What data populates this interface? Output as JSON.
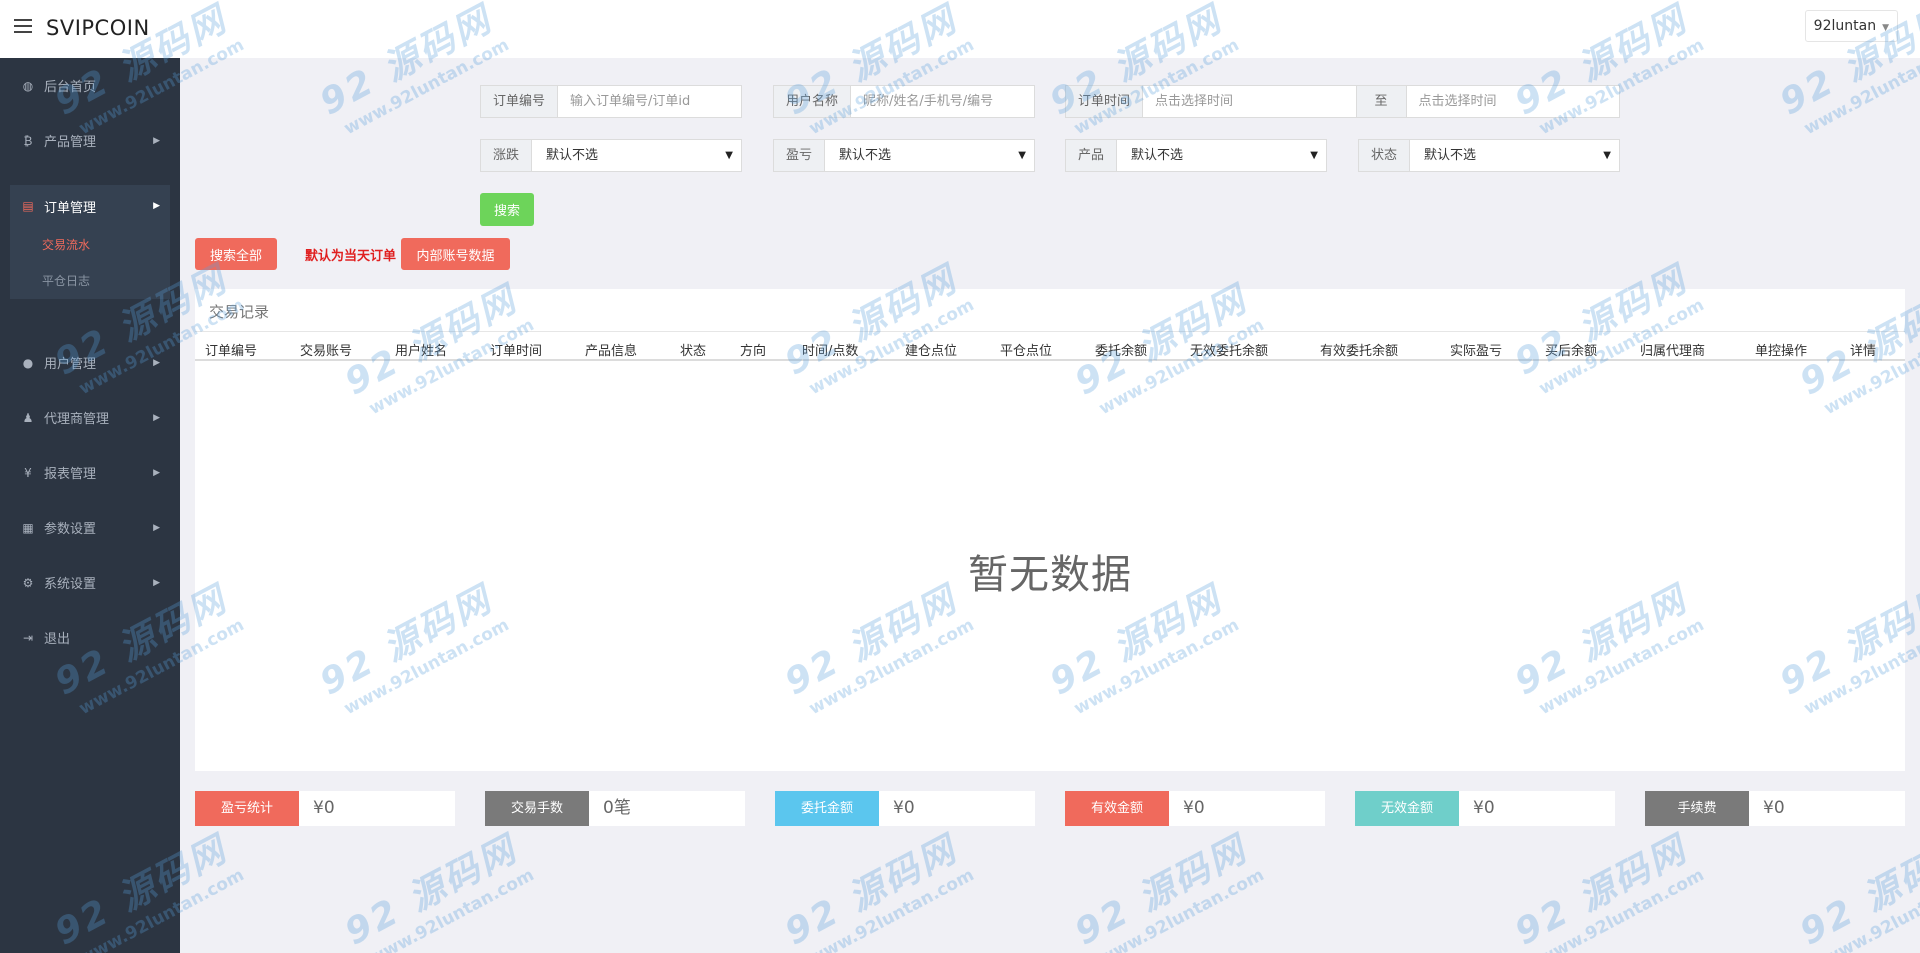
{
  "header": {
    "logo": "SVIPCOIN",
    "user": "92luntan"
  },
  "sidebar": {
    "items": [
      {
        "icon": "dashboard-icon",
        "glyph": "◍",
        "label": "后台首页"
      },
      {
        "icon": "bitcoin-icon",
        "glyph": "₿",
        "label": "产品管理"
      },
      {
        "icon": "orders-icon",
        "glyph": "▤",
        "label": "订单管理"
      },
      {
        "icon": "user-icon",
        "glyph": "●",
        "label": "用户管理"
      },
      {
        "icon": "agent-icon",
        "glyph": "♟",
        "label": "代理商管理"
      },
      {
        "icon": "yen-icon",
        "glyph": "¥",
        "label": "报表管理"
      },
      {
        "icon": "params-icon",
        "glyph": "▦",
        "label": "参数设置"
      },
      {
        "icon": "gears-icon",
        "glyph": "⚙",
        "label": "系统设置"
      },
      {
        "icon": "logout-icon",
        "glyph": "⇥",
        "label": "退出"
      }
    ],
    "sub_items": [
      {
        "label": "交易流水"
      },
      {
        "label": "平仓日志"
      }
    ]
  },
  "filters": {
    "order_no": {
      "label": "订单编号",
      "placeholder": "输入订单编号/订单id"
    },
    "user_name": {
      "label": "用户名称",
      "placeholder": "昵称/姓名/手机号/编号"
    },
    "order_time": {
      "label": "订单时间",
      "placeholder": "点击选择时间",
      "to": "至",
      "placeholder2": "点击选择时间"
    },
    "rise_fall": {
      "label": "涨跌",
      "value": "默认不选"
    },
    "profit_loss": {
      "label": "盈亏",
      "value": "默认不选"
    },
    "product": {
      "label": "产品",
      "value": "默认不选"
    },
    "status": {
      "label": "状态",
      "value": "默认不选"
    },
    "search_button": "搜索"
  },
  "actions": {
    "search_all": "搜索全部",
    "default_note": "默认为当天订单",
    "internal_accounts": "内部账号数据"
  },
  "table": {
    "title": "交易记录",
    "columns": [
      "订单编号",
      "交易账号",
      "用户姓名",
      "订单时间",
      "产品信息",
      "状态",
      "方向",
      "时间/点数",
      "建仓点位",
      "平仓点位",
      "委托余额",
      "无效委托余额",
      "有效委托余额",
      "实际盈亏",
      "买后余额",
      "归属代理商",
      "单控操作",
      "详情"
    ],
    "empty": "暂无数据"
  },
  "summary": [
    {
      "label": "盈亏统计",
      "value": "¥0",
      "color": "#f06a5c"
    },
    {
      "label": "交易手数",
      "value": "0笔",
      "color": "#7a7a7a"
    },
    {
      "label": "委托金额",
      "value": "¥0",
      "color": "#5bc6ee"
    },
    {
      "label": "有效金额",
      "value": "¥0",
      "color": "#f06a5c"
    },
    {
      "label": "无效金额",
      "value": "¥0",
      "color": "#6fcfca"
    },
    {
      "label": "手续费",
      "value": "¥0",
      "color": "#7a7a7a"
    }
  ],
  "watermark": {
    "logo": "92 源码网",
    "url": "www.92luntan.com"
  }
}
